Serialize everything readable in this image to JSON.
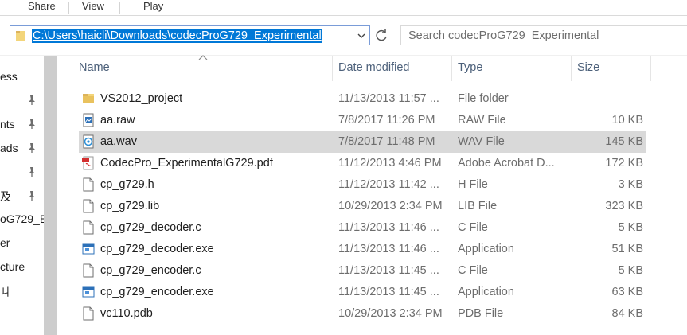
{
  "ribbon": {
    "tabs": [
      "Share",
      "View",
      "Play"
    ]
  },
  "address": {
    "path": "C:\\Users\\haicli\\Downloads\\codecProG729_Experimental"
  },
  "search": {
    "placeholder": "Search codecProG729_Experimental"
  },
  "nav": {
    "items": [
      "ess",
      "nts",
      "ads",
      "",
      "及",
      "oG729_E",
      "er",
      "cture",
      "ㄐ"
    ]
  },
  "columns": {
    "name": "Name",
    "date": "Date modified",
    "type": "Type",
    "size": "Size"
  },
  "files": [
    {
      "name": "VS2012_project",
      "date": "11/13/2013 11:57 ...",
      "type": "File folder",
      "size": "",
      "icon": "folder-icon"
    },
    {
      "name": "aa.raw",
      "date": "7/8/2017 11:26 PM",
      "type": "RAW File",
      "size": "10 KB",
      "icon": "image-file-icon"
    },
    {
      "name": "aa.wav",
      "date": "7/8/2017 11:48 PM",
      "type": "WAV File",
      "size": "145 KB",
      "icon": "audio-file-icon"
    },
    {
      "name": "CodecPro_ExperimentalG729.pdf",
      "date": "11/12/2013 4:46 PM",
      "type": "Adobe Acrobat D...",
      "size": "172 KB",
      "icon": "pdf-file-icon"
    },
    {
      "name": "cp_g729.h",
      "date": "11/12/2013 11:42 ...",
      "type": "H File",
      "size": "3 KB",
      "icon": "generic-file-icon"
    },
    {
      "name": "cp_g729.lib",
      "date": "10/29/2013 2:34 PM",
      "type": "LIB File",
      "size": "323 KB",
      "icon": "generic-file-icon"
    },
    {
      "name": "cp_g729_decoder.c",
      "date": "11/13/2013 11:46 ...",
      "type": "C File",
      "size": "5 KB",
      "icon": "generic-file-icon"
    },
    {
      "name": "cp_g729_decoder.exe",
      "date": "11/13/2013 11:46 ...",
      "type": "Application",
      "size": "51 KB",
      "icon": "application-icon"
    },
    {
      "name": "cp_g729_encoder.c",
      "date": "11/13/2013 11:45 ...",
      "type": "C File",
      "size": "5 KB",
      "icon": "generic-file-icon"
    },
    {
      "name": "cp_g729_encoder.exe",
      "date": "11/13/2013 11:45 ...",
      "type": "Application",
      "size": "63 KB",
      "icon": "application-icon"
    },
    {
      "name": "vc110.pdb",
      "date": "10/29/2013 2:34 PM",
      "type": "PDB File",
      "size": "84 KB",
      "icon": "generic-file-icon"
    }
  ],
  "selected_file": "aa.wav",
  "colors": {
    "selection": "#d9d9d9",
    "address_highlight": "#0078d7",
    "folder": "#dcb35c"
  }
}
